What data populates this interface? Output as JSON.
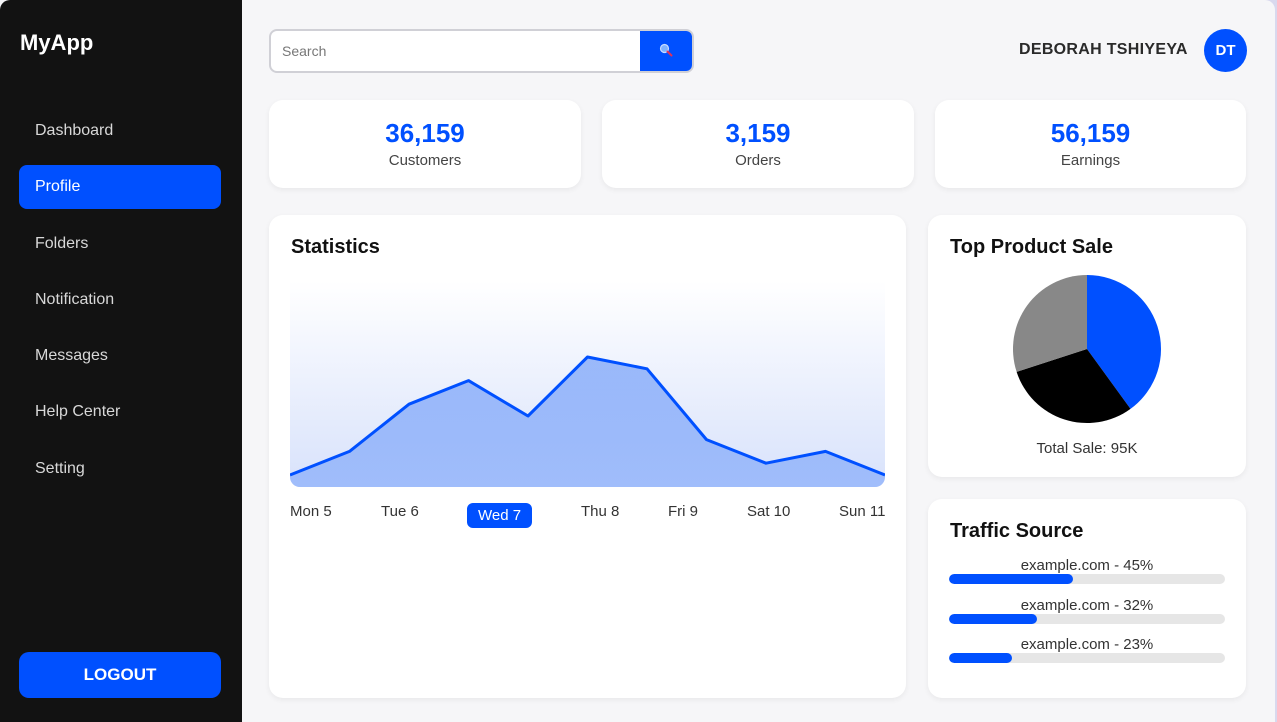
{
  "app": {
    "title": "MyApp"
  },
  "sidebar": {
    "items": [
      {
        "label": "Dashboard",
        "active": false
      },
      {
        "label": "Profile",
        "active": true
      },
      {
        "label": "Folders",
        "active": false
      },
      {
        "label": "Notification",
        "active": false
      },
      {
        "label": "Messages",
        "active": false
      },
      {
        "label": "Help Center",
        "active": false
      },
      {
        "label": "Setting",
        "active": false
      }
    ],
    "logout_label": "LOGOUT"
  },
  "header": {
    "search": {
      "placeholder": "Search",
      "value": "",
      "icon": "search-icon"
    },
    "user": {
      "name": "DEBORAH TSHIYEYA",
      "initials": "DT"
    }
  },
  "stats": [
    {
      "value": "36,159",
      "label": "Customers"
    },
    {
      "value": "3,159",
      "label": "Orders"
    },
    {
      "value": "56,159",
      "label": "Earnings"
    }
  ],
  "statistics": {
    "title": "Statistics",
    "selected_day": "Wed 7"
  },
  "top_product": {
    "title": "Top Product Sale",
    "total": "Total Sale: 95K"
  },
  "traffic": {
    "title": "Traffic Source",
    "sources": [
      {
        "label": "example.com - 45%",
        "percent": 45
      },
      {
        "label": "example.com - 32%",
        "percent": 32
      },
      {
        "label": "example.com - 23%",
        "percent": 23
      }
    ]
  },
  "colors": {
    "accent": "#0050ff",
    "sidebar": "#121212",
    "background": "#f6f6f8"
  },
  "chart_data": [
    {
      "type": "area",
      "title": "Statistics",
      "categories": [
        "Mon 5",
        "Tue 6",
        "Wed 7",
        "Thu 8",
        "Fri 9",
        "Sat 10",
        "Sun 11"
      ],
      "x": [
        0,
        1,
        2,
        3,
        4,
        5,
        6,
        7,
        8,
        9,
        10
      ],
      "values": [
        0,
        2,
        6,
        8,
        5,
        10,
        9,
        3,
        1,
        2,
        0
      ],
      "ylim": [
        0,
        10
      ],
      "grid": false,
      "color": "#0050ff"
    },
    {
      "type": "pie",
      "title": "Top Product Sale",
      "slices": [
        {
          "value": 40,
          "color": "#0050ff"
        },
        {
          "value": 30,
          "color": "#000000"
        },
        {
          "value": 30,
          "color": "#888888"
        }
      ]
    }
  ]
}
